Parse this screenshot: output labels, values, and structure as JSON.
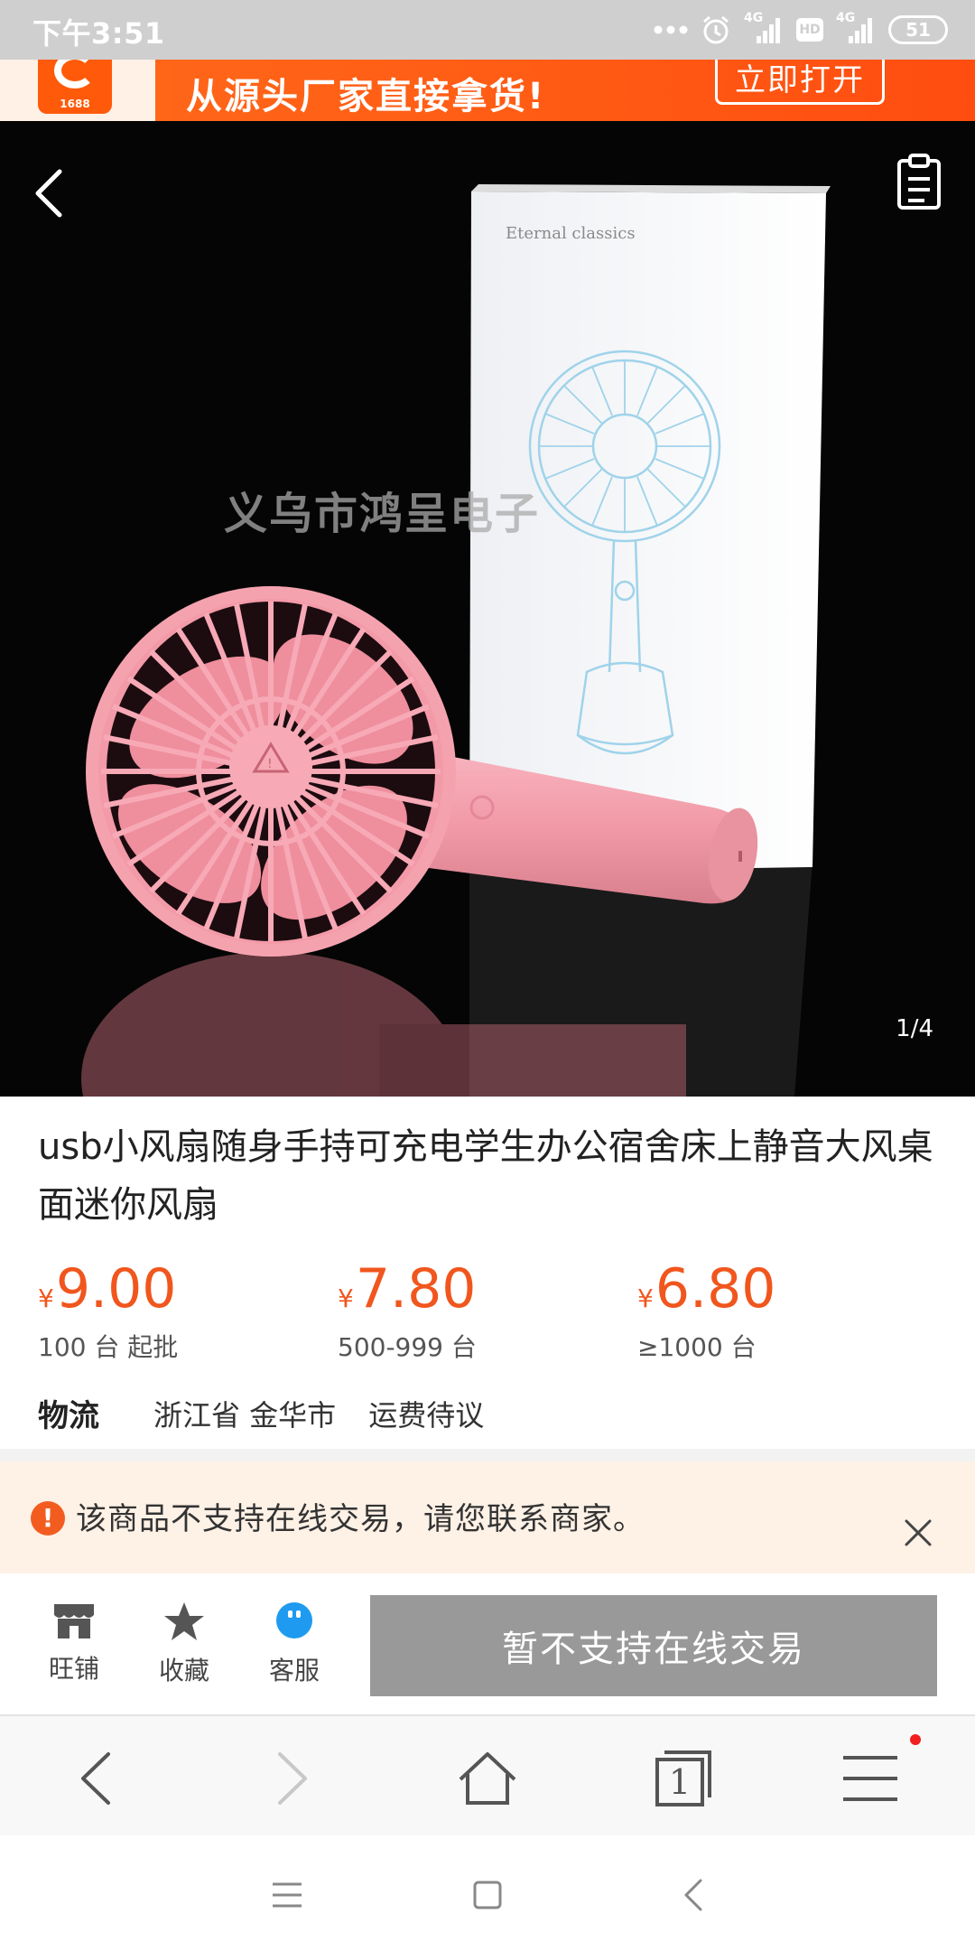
{
  "status_bar": {
    "time": "下午3:51",
    "network_1": "4G",
    "hd": "HD",
    "network_2": "4G",
    "battery": "51"
  },
  "promo": {
    "logo_number": "1688",
    "text": "从源头厂家直接拿货!",
    "open_button": "立即打开"
  },
  "hero": {
    "box_text": "Eternal classics",
    "watermark": "义乌市鸿呈电子",
    "page_indicator": "1/4",
    "colors": {
      "fan": "#f4a4b0",
      "background": "#050505"
    }
  },
  "product": {
    "title": "usb小风扇随身手持可充电学生办公宿舍床上静音大风桌面迷你风扇",
    "tiers": [
      {
        "currency": "¥",
        "price": "9.00",
        "condition": "100 台 起批"
      },
      {
        "currency": "¥",
        "price": "7.80",
        "condition": "500-999 台"
      },
      {
        "currency": "¥",
        "price": "6.80",
        "condition": "≥1000 台"
      }
    ],
    "logistics": {
      "label": "物流",
      "location": "浙江省 金华市",
      "shipping": "运费待议"
    },
    "accent_color": "#f0561d"
  },
  "notice": {
    "text": "该商品不支持在线交易，请您联系商家。"
  },
  "actions": {
    "shop": "旺铺",
    "favorite": "收藏",
    "service": "客服",
    "unavailable_button": "暂不支持在线交易"
  },
  "browser_nav": {
    "tab_count": "1",
    "icons": [
      "back-icon",
      "forward-icon",
      "home-icon",
      "tabs-icon",
      "menu-icon"
    ]
  }
}
